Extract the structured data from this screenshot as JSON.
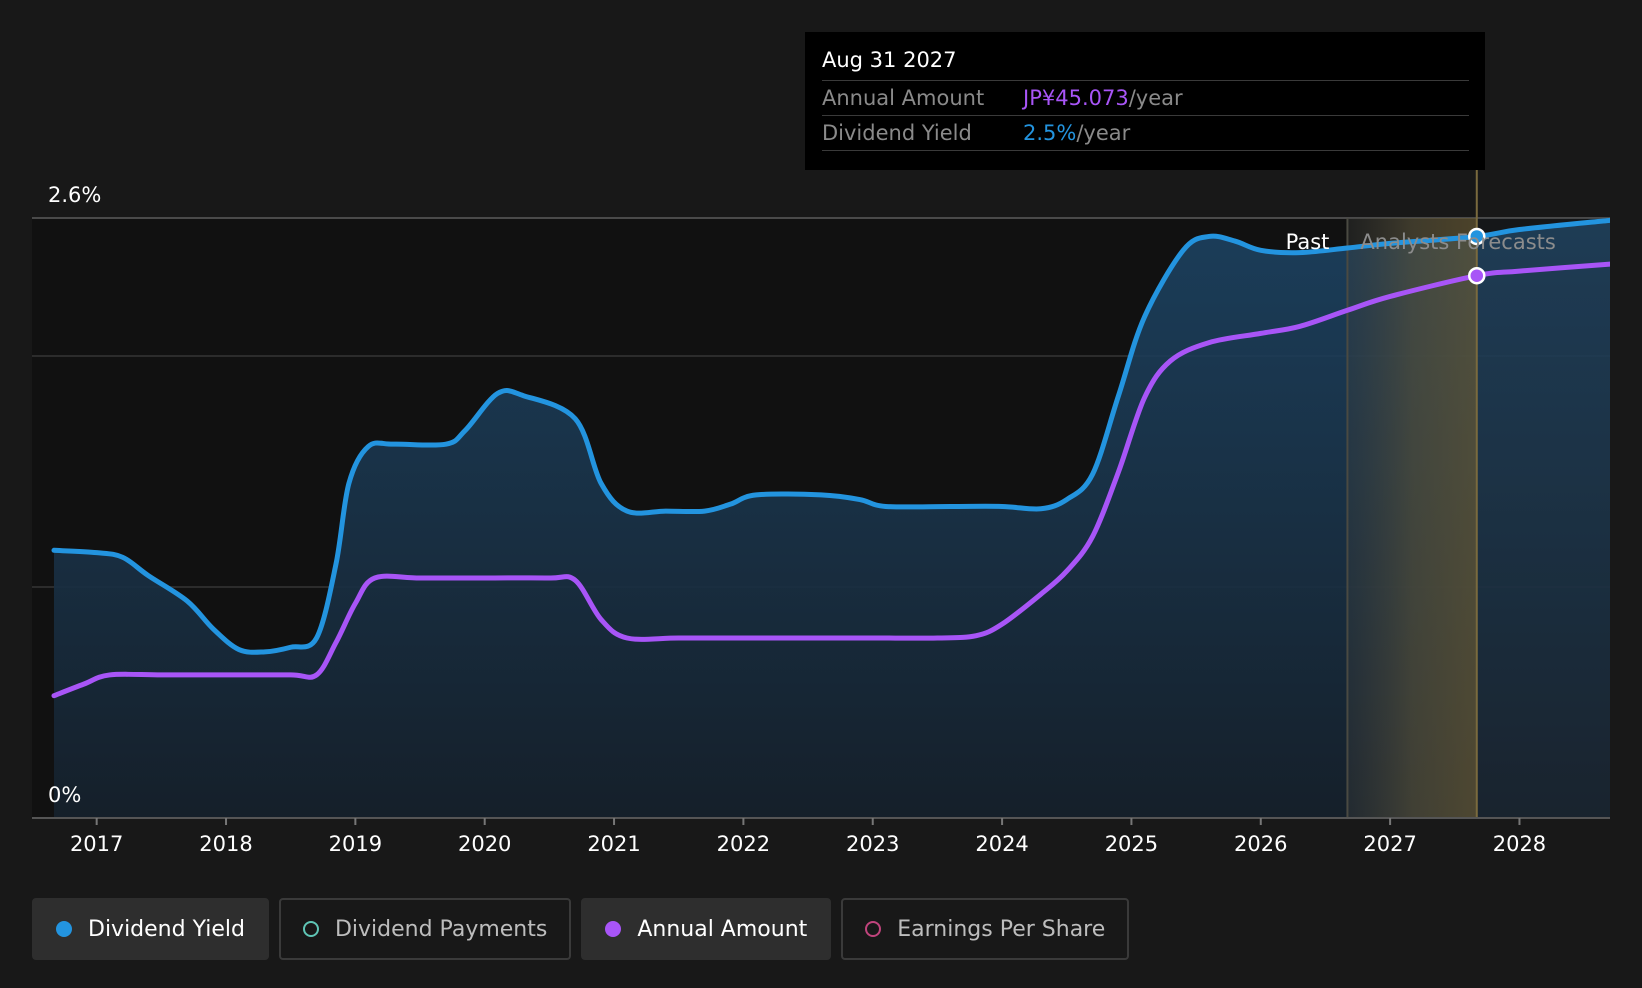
{
  "tooltip": {
    "date": "Aug 31 2027",
    "rows": [
      {
        "label": "Annual Amount",
        "value": "JP¥45.073",
        "unit": "/year",
        "color": "#a855f7"
      },
      {
        "label": "Dividend Yield",
        "value": "2.5%",
        "unit": "/year",
        "color": "#2394df"
      }
    ]
  },
  "region_labels": {
    "past": "Past",
    "forecast": "Analysts Forecasts"
  },
  "legend": [
    {
      "label": "Dividend Yield",
      "color": "#2394df",
      "active": true
    },
    {
      "label": "Dividend Payments",
      "color": "#5fc5b5",
      "active": false
    },
    {
      "label": "Annual Amount",
      "color": "#a855f7",
      "active": true
    },
    {
      "label": "Earnings Per Share",
      "color": "#c0447c",
      "active": false
    }
  ],
  "chart_data": {
    "type": "area",
    "y_tick_labels": [
      "2.6%",
      "0%"
    ],
    "ylim": [
      0,
      2.6
    ],
    "x_tick_labels": [
      "2017",
      "2018",
      "2019",
      "2020",
      "2021",
      "2022",
      "2023",
      "2024",
      "2025",
      "2026",
      "2027",
      "2028"
    ],
    "xlim": [
      2016.5,
      2028.7
    ],
    "forecast_start": 2026.67,
    "highlight_x": 2027.67,
    "grid": true,
    "series": [
      {
        "name": "Dividend Yield",
        "color": "#2394df",
        "fill": true,
        "points": [
          [
            2016.67,
            1.16
          ],
          [
            2017.0,
            1.15
          ],
          [
            2017.2,
            1.13
          ],
          [
            2017.4,
            1.05
          ],
          [
            2017.7,
            0.94
          ],
          [
            2017.9,
            0.82
          ],
          [
            2018.1,
            0.73
          ],
          [
            2018.3,
            0.72
          ],
          [
            2018.5,
            0.74
          ],
          [
            2018.7,
            0.78
          ],
          [
            2018.85,
            1.1
          ],
          [
            2018.95,
            1.45
          ],
          [
            2019.1,
            1.61
          ],
          [
            2019.3,
            1.62
          ],
          [
            2019.7,
            1.62
          ],
          [
            2019.85,
            1.68
          ],
          [
            2020.1,
            1.84
          ],
          [
            2020.3,
            1.83
          ],
          [
            2020.7,
            1.73
          ],
          [
            2020.9,
            1.45
          ],
          [
            2021.1,
            1.33
          ],
          [
            2021.4,
            1.33
          ],
          [
            2021.7,
            1.33
          ],
          [
            2021.9,
            1.36
          ],
          [
            2022.1,
            1.4
          ],
          [
            2022.6,
            1.4
          ],
          [
            2022.9,
            1.38
          ],
          [
            2023.1,
            1.35
          ],
          [
            2023.6,
            1.35
          ],
          [
            2024.0,
            1.35
          ],
          [
            2024.3,
            1.34
          ],
          [
            2024.5,
            1.38
          ],
          [
            2024.7,
            1.49
          ],
          [
            2024.9,
            1.83
          ],
          [
            2025.1,
            2.17
          ],
          [
            2025.4,
            2.46
          ],
          [
            2025.6,
            2.52
          ],
          [
            2025.8,
            2.5
          ],
          [
            2026.0,
            2.46
          ],
          [
            2026.3,
            2.45
          ],
          [
            2026.67,
            2.47
          ],
          [
            2027.0,
            2.49
          ],
          [
            2027.67,
            2.52
          ],
          [
            2028.0,
            2.55
          ],
          [
            2028.7,
            2.59
          ]
        ]
      },
      {
        "name": "Annual Amount",
        "color": "#a855f7",
        "fill": false,
        "points": [
          [
            2016.67,
            0.53
          ],
          [
            2016.9,
            0.58
          ],
          [
            2017.1,
            0.62
          ],
          [
            2017.5,
            0.62
          ],
          [
            2018.0,
            0.62
          ],
          [
            2018.5,
            0.62
          ],
          [
            2018.7,
            0.62
          ],
          [
            2018.85,
            0.76
          ],
          [
            2019.0,
            0.93
          ],
          [
            2019.15,
            1.04
          ],
          [
            2019.5,
            1.04
          ],
          [
            2020.0,
            1.04
          ],
          [
            2020.5,
            1.04
          ],
          [
            2020.7,
            1.03
          ],
          [
            2020.9,
            0.86
          ],
          [
            2021.1,
            0.78
          ],
          [
            2021.5,
            0.78
          ],
          [
            2022.0,
            0.78
          ],
          [
            2022.5,
            0.78
          ],
          [
            2023.0,
            0.78
          ],
          [
            2023.5,
            0.78
          ],
          [
            2023.8,
            0.79
          ],
          [
            2024.0,
            0.84
          ],
          [
            2024.3,
            0.97
          ],
          [
            2024.5,
            1.07
          ],
          [
            2024.7,
            1.22
          ],
          [
            2024.9,
            1.5
          ],
          [
            2025.1,
            1.82
          ],
          [
            2025.3,
            1.98
          ],
          [
            2025.6,
            2.06
          ],
          [
            2026.0,
            2.1
          ],
          [
            2026.3,
            2.13
          ],
          [
            2026.67,
            2.2
          ],
          [
            2027.0,
            2.26
          ],
          [
            2027.67,
            2.35
          ],
          [
            2028.0,
            2.37
          ],
          [
            2028.7,
            2.4
          ]
        ]
      }
    ]
  }
}
